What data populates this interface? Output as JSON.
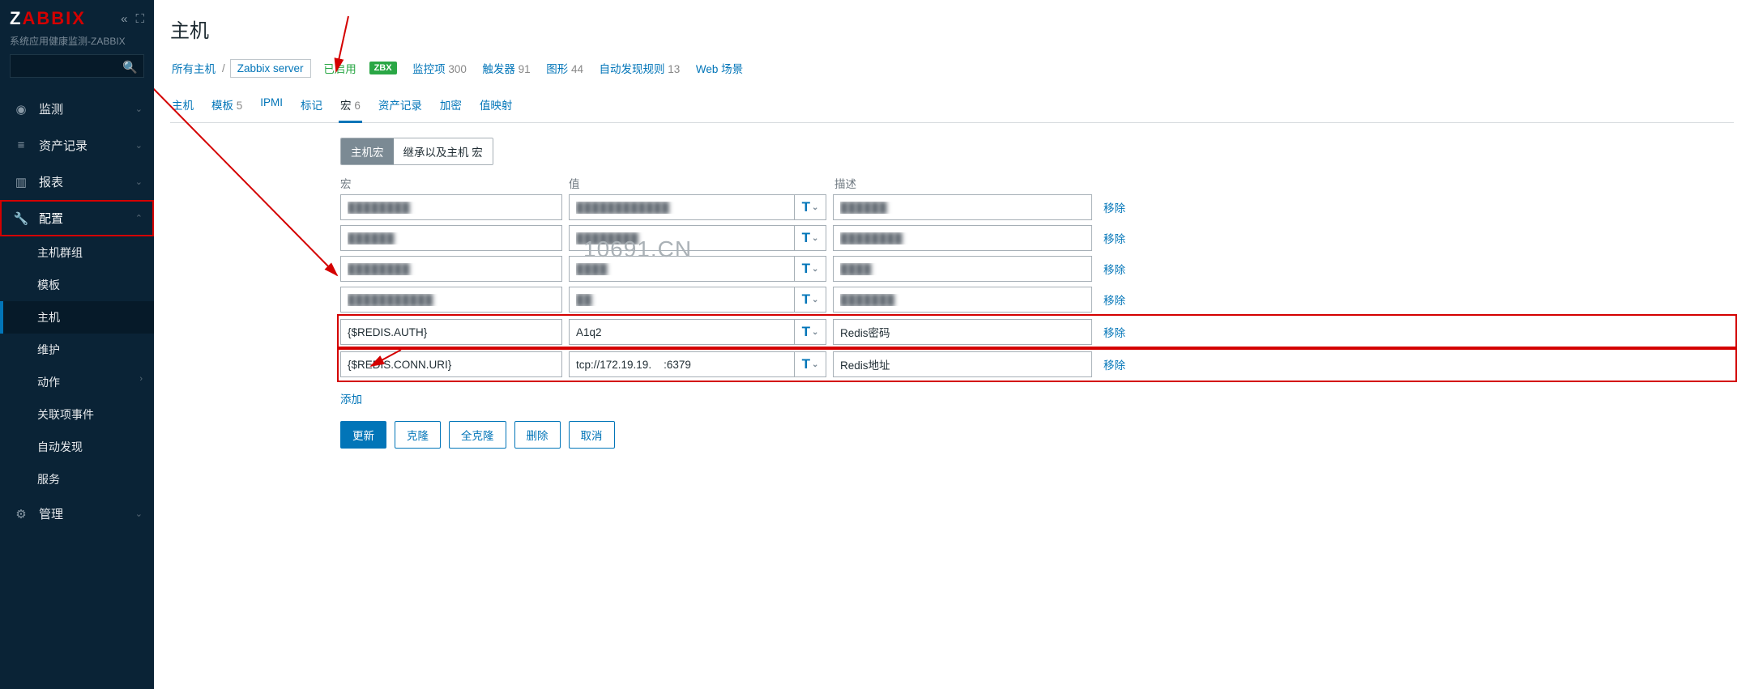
{
  "brand": {
    "name": "ZABBIX",
    "subtitle": "系统应用健康监测-ZABBIX"
  },
  "search": {
    "placeholder": ""
  },
  "nav": {
    "monitor": "监测",
    "inventory": "资产记录",
    "reports": "报表",
    "config": "配置",
    "admin": "管理",
    "sub": {
      "hostgroups": "主机群组",
      "templates": "模板",
      "hosts": "主机",
      "maintenance": "维护",
      "actions": "动作",
      "correlation": "关联项事件",
      "discovery": "自动发现",
      "services": "服务"
    }
  },
  "page": {
    "title": "主机"
  },
  "crumbs": {
    "all_hosts": "所有主机",
    "host": "Zabbix server",
    "enabled": "已启用",
    "zbx": "ZBX",
    "items_label": "监控项",
    "items_n": "300",
    "triggers_label": "触发器",
    "triggers_n": "91",
    "graphs_label": "图形",
    "graphs_n": "44",
    "discovery_label": "自动发现规则",
    "discovery_n": "13",
    "web_label": "Web 场景"
  },
  "tabs": {
    "host": "主机",
    "templates_label": "模板",
    "templates_n": "5",
    "ipmi": "IPMI",
    "tags": "标记",
    "macros_label": "宏",
    "macros_n": "6",
    "inventory": "资产记录",
    "encryption": "加密",
    "valuemap": "值映射"
  },
  "seg": {
    "host_macros": "主机宏",
    "inherited": "继承以及主机 宏"
  },
  "cols": {
    "macro": "宏",
    "value": "值",
    "desc": "描述"
  },
  "rows": [
    {
      "macro": "████████",
      "value": "████████████",
      "desc": "██████"
    },
    {
      "macro": "██████",
      "value": "████████",
      "desc": "████████"
    },
    {
      "macro": "████████",
      "value": "████",
      "desc": "████"
    },
    {
      "macro": "███████████",
      "value": "██",
      "desc": "███████"
    },
    {
      "macro": "{$REDIS.AUTH}",
      "value": "A1q2",
      "desc": "Redis密码"
    },
    {
      "macro": "{$REDIS.CONN.URI}",
      "value": "tcp://172.19.19.    :6379",
      "desc": "Redis地址"
    }
  ],
  "type_btn": "T",
  "remove_label": "移除",
  "add_link": "添加",
  "buttons": {
    "update": "更新",
    "clone": "克隆",
    "fullclone": "全克隆",
    "delete": "删除",
    "cancel": "取消"
  },
  "watermark": "10691.CN"
}
